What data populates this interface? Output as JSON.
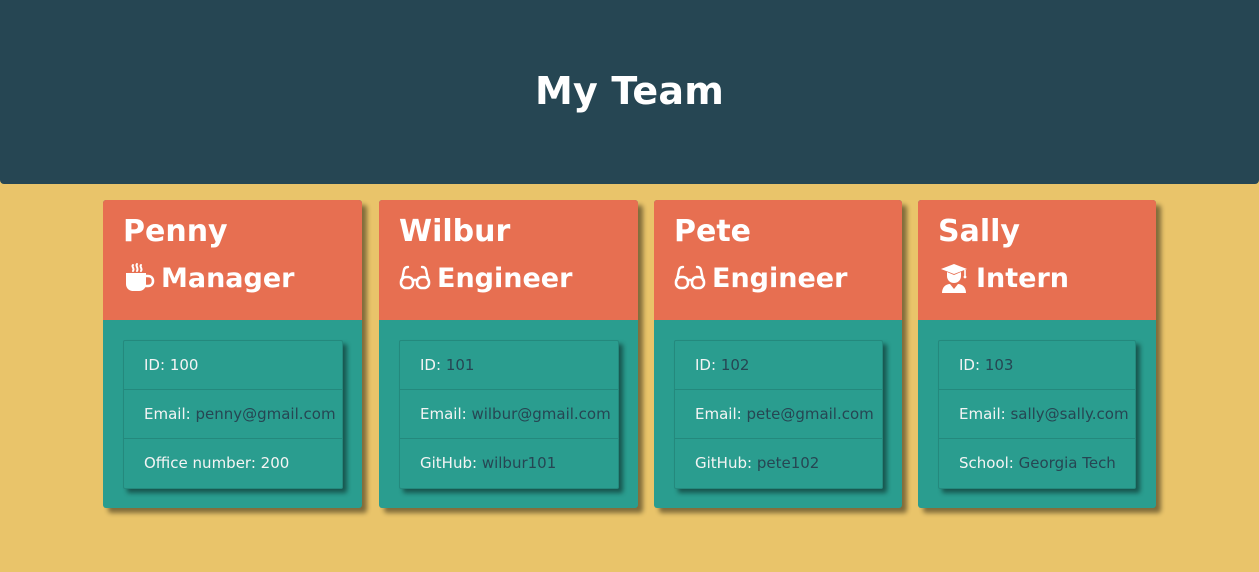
{
  "header": {
    "title": "My Team"
  },
  "team": [
    {
      "name": "Penny",
      "role": "Manager",
      "role_icon": "coffee-icon",
      "id_label": "ID:",
      "id_value": "100",
      "email_label": "Email:",
      "email_value": "penny@gmail.com",
      "extra_label": "Office number:",
      "extra_value": "200"
    },
    {
      "name": "Wilbur",
      "role": "Engineer",
      "role_icon": "glasses-icon",
      "id_label": "ID:",
      "id_value": "101",
      "email_label": "Email:",
      "email_value": "wilbur@gmail.com",
      "extra_label": "GitHub:",
      "extra_value": "wilbur101"
    },
    {
      "name": "Pete",
      "role": "Engineer",
      "role_icon": "glasses-icon",
      "id_label": "ID:",
      "id_value": "102",
      "email_label": "Email:",
      "email_value": "pete@gmail.com",
      "extra_label": "GitHub:",
      "extra_value": "pete102"
    },
    {
      "name": "Sally",
      "role": "Intern",
      "role_icon": "graduate-icon",
      "id_label": "ID:",
      "id_value": "103",
      "email_label": "Email:",
      "email_value": "sally@sally.com",
      "extra_label": "School:",
      "extra_value": "Georgia Tech"
    }
  ],
  "colors": {
    "background": "#E9C46A",
    "header": "#264653",
    "card_header": "#E76F51",
    "card_body": "#2A9D8F",
    "value_text": "#264653",
    "label_text": "#f4f4f4"
  }
}
